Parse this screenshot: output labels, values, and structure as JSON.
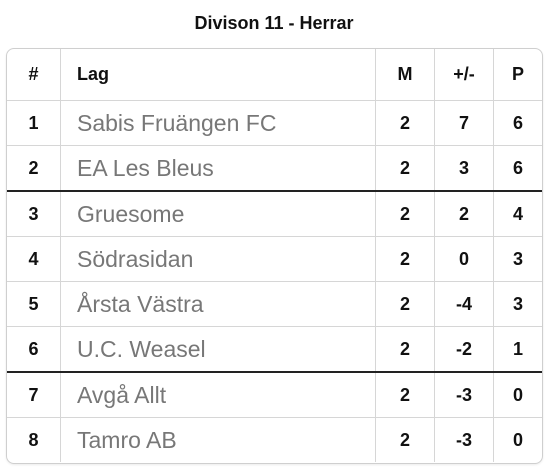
{
  "title": "Divison 11 - Herrar",
  "headers": {
    "rank": "#",
    "team": "Lag",
    "matches": "M",
    "diff": "+/-",
    "points": "P"
  },
  "rows": [
    {
      "rank": "1",
      "team": "Sabis Fruängen FC",
      "matches": "2",
      "diff": "7",
      "points": "6"
    },
    {
      "rank": "2",
      "team": "EA Les Bleus",
      "matches": "2",
      "diff": "3",
      "points": "6"
    },
    {
      "rank": "3",
      "team": "Gruesome",
      "matches": "2",
      "diff": "2",
      "points": "4"
    },
    {
      "rank": "4",
      "team": "Södrasidan",
      "matches": "2",
      "diff": "0",
      "points": "3"
    },
    {
      "rank": "5",
      "team": "Årsta Västra",
      "matches": "2",
      "diff": "-4",
      "points": "3"
    },
    {
      "rank": "6",
      "team": "U.C. Weasel",
      "matches": "2",
      "diff": "-2",
      "points": "1"
    },
    {
      "rank": "7",
      "team": "Avgå Allt",
      "matches": "2",
      "diff": "-3",
      "points": "0"
    },
    {
      "rank": "8",
      "team": "Tamro AB",
      "matches": "2",
      "diff": "-3",
      "points": "0"
    }
  ],
  "colors": {
    "team_text": "#777777",
    "separator": "#222222",
    "border": "#d6d6d6"
  }
}
